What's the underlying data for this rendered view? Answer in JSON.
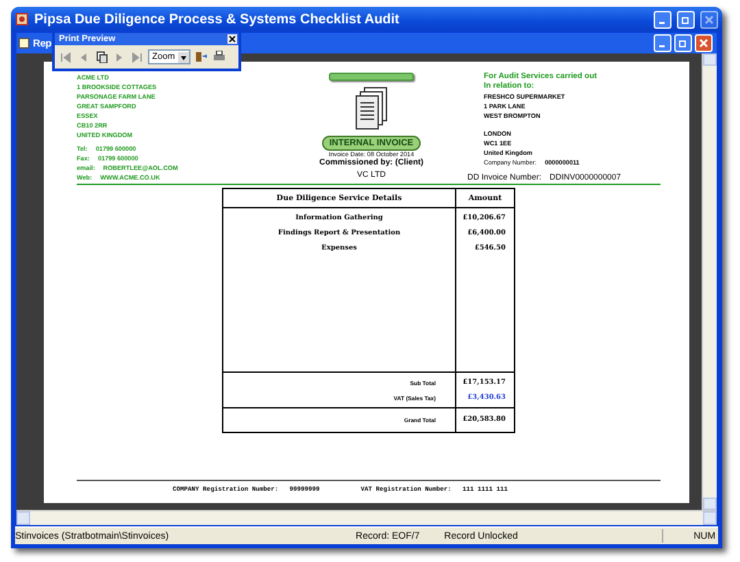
{
  "window": {
    "title": "Pipsa Due Diligence Process & Systems Checklist Audit"
  },
  "document_window": {
    "title": "Rep"
  },
  "print_preview": {
    "title": "Print Preview",
    "zoom": "Zoom"
  },
  "invoice": {
    "from_lines": [
      "ACME LTD",
      "1 BROOKSIDE COTTAGES",
      "PARSONAGE FARM LANE",
      "GREAT SAMPFORD",
      "ESSEX",
      "CB10 2RR",
      "UNITED KINGDOM"
    ],
    "contacts": [
      {
        "label": "Tel:",
        "value": "01799 600000"
      },
      {
        "label": "Fax:",
        "value": "01799 600000"
      },
      {
        "label": "email:",
        "value": "ROBERTLEE@AOL.COM"
      },
      {
        "label": "Web:",
        "value": "WWW.ACME.CO.UK"
      }
    ],
    "badge": "INTERNAL INVOICE",
    "invoice_date": "Invoice Date: 08 October 2014",
    "commissioned": "Commissioned by: (Client)",
    "client": "VC LTD",
    "to_heading": [
      "For Audit Services carried out",
      "In relation to:"
    ],
    "to_lines_1": [
      "FRESHCO SUPERMARKET",
      "1 PARK LANE",
      "WEST BROMPTON"
    ],
    "to_lines_2": [
      "LONDON",
      "WC1 1EE",
      "United Kingdom"
    ],
    "company_number": {
      "label": "Company Number:",
      "value": "0000000011"
    },
    "invoice_number": {
      "label": "DD Invoice Number:",
      "value": "DDINV0000000007"
    },
    "columns": [
      "Due Diligence Service Details",
      "Amount"
    ],
    "rows": [
      {
        "detail": "Information Gathering",
        "amount": "£10,206.67"
      },
      {
        "detail": "Findings Report & Presentation",
        "amount": "£6,400.00"
      },
      {
        "detail": "Expenses",
        "amount": "£546.50"
      }
    ],
    "totals": [
      {
        "label": "Sub Total",
        "value": "£17,153.17",
        "color": "#000000"
      },
      {
        "label": "VAT (Sales Tax)",
        "value": "£3,430.63",
        "color": "#1f3fd8"
      }
    ],
    "grand_total": {
      "label": "Grand Total",
      "value": "£20,583.80"
    },
    "footer": [
      {
        "label": "COMPANY Registration Number:",
        "value": "99999999"
      },
      {
        "label": "VAT Registration Number:",
        "value": "111 1111 111"
      }
    ]
  },
  "status_bar": {
    "source": "Stinvoices (Stratbotmain\\Stinvoices)",
    "record": "Record: EOF/7",
    "lock": "Record Unlocked",
    "num": "NUM"
  }
}
